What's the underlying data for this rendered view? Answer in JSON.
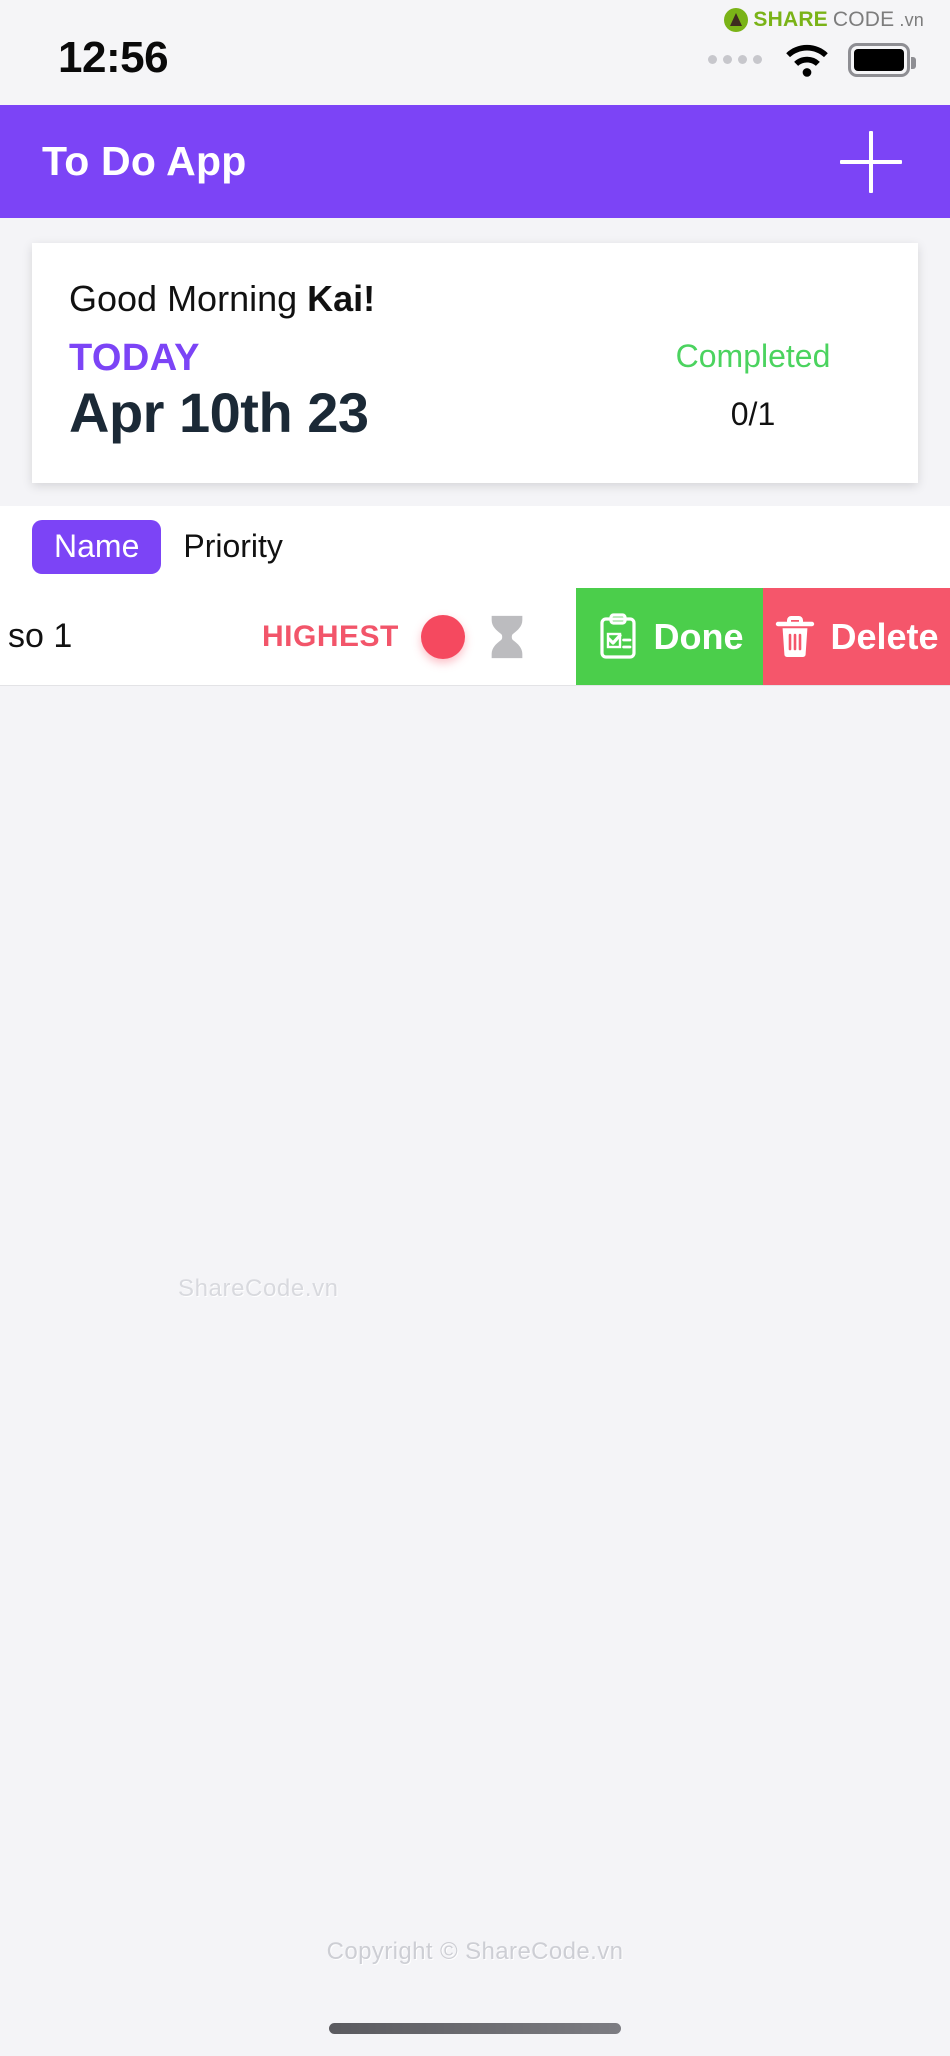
{
  "statusbar": {
    "time": "12:56",
    "signal_icon": "signal-dots-icon",
    "wifi_icon": "wifi-icon",
    "battery_icon": "battery-icon",
    "watermark": {
      "share": "SHARE",
      "code": "CODE",
      "tld": ".vn",
      "logo_icon": "sharecode-logo-icon"
    }
  },
  "appbar": {
    "title": "To Do App",
    "add_icon": "plus-icon",
    "background": "#7c44f6"
  },
  "card": {
    "greeting_prefix": "Good Morning ",
    "greeting_name": "Kai!",
    "today_label": "TODAY",
    "date": "Apr 10th 23",
    "completed_label": "Completed",
    "completed_count": "0/1",
    "completed_color": "#4bd35f",
    "today_color": "#7c44f6",
    "date_color": "#1b2936"
  },
  "sortbar": {
    "options": [
      {
        "label": "Name",
        "selected": true
      },
      {
        "label": "Priority",
        "selected": false
      }
    ]
  },
  "task": {
    "name": "so 1",
    "priority_label": "HIGHEST",
    "priority_color": "#f5495f",
    "dot_icon": "priority-dot-icon",
    "status_icon": "hourglass-icon",
    "actions": [
      {
        "label": "Done",
        "icon": "clipboard-check-icon",
        "color": "#4bce4b"
      },
      {
        "label": "Delete",
        "icon": "trash-icon",
        "color": "#f5566b"
      }
    ]
  },
  "watermarks": {
    "center": "ShareCode.vn",
    "bottom": "Copyright © ShareCode.vn"
  }
}
